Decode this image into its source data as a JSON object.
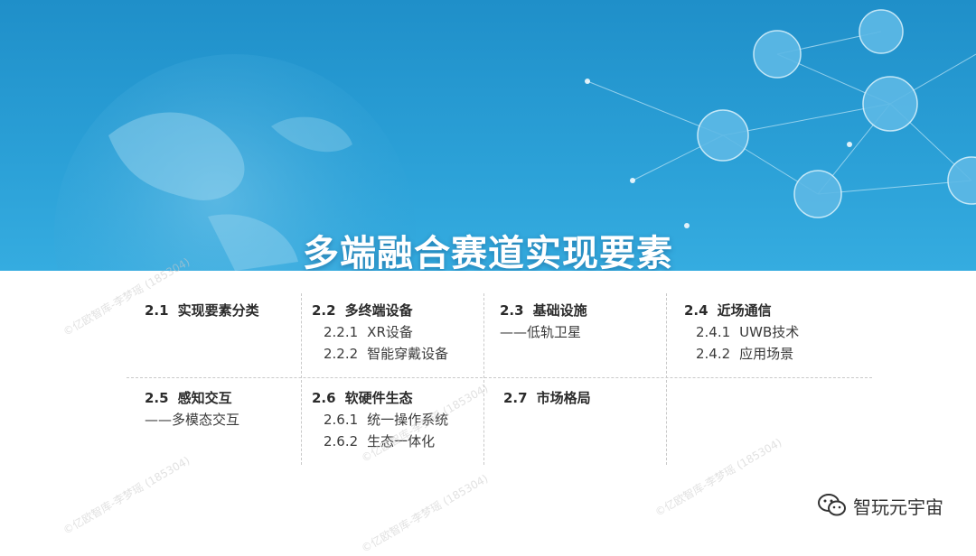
{
  "slide": {
    "title": "多端融合赛道实现要素",
    "brand": "智玩元宇宙",
    "watermark": "©亿欧智库-李梦瑶 (185304)"
  },
  "sections": [
    {
      "number": "2.1",
      "label": "实现要素分类",
      "subs": [],
      "note": ""
    },
    {
      "number": "2.2",
      "label": "多终端设备",
      "subs": [
        {
          "number": "2.2.1",
          "label": "XR设备"
        },
        {
          "number": "2.2.2",
          "label": "智能穿戴设备"
        }
      ],
      "note": ""
    },
    {
      "number": "2.3",
      "label": "基础设施",
      "subs": [],
      "note": "——低轨卫星"
    },
    {
      "number": "2.4",
      "label": "近场通信",
      "subs": [
        {
          "number": "2.4.1",
          "label": "UWB技术"
        },
        {
          "number": "2.4.2",
          "label": "应用场景"
        }
      ],
      "note": ""
    },
    {
      "number": "2.5",
      "label": "感知交互",
      "subs": [],
      "note": "——多模态交互"
    },
    {
      "number": "2.6",
      "label": "软硬件生态",
      "subs": [
        {
          "number": "2.6.1",
          "label": "统一操作系统"
        },
        {
          "number": "2.6.2",
          "label": "生态一体化"
        }
      ],
      "note": ""
    },
    {
      "number": "2.7",
      "label": "市场格局",
      "subs": [],
      "note": ""
    }
  ],
  "colors": {
    "banner": "#2a9fd6",
    "text": "#333333"
  }
}
